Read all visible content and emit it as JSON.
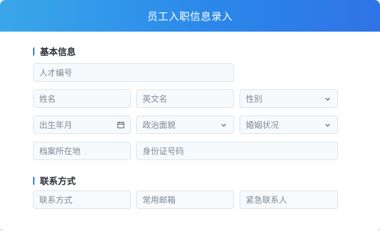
{
  "header": {
    "title": "员工入职信息录入"
  },
  "colors": {
    "accent": "#2b7de9",
    "header_start": "#3aa7e9",
    "header_end": "#2f73e6"
  },
  "sections": {
    "basic": {
      "title": "基本信息"
    },
    "contact": {
      "title": "联系方式"
    }
  },
  "fields": {
    "talent_no": {
      "placeholder": "人才编号"
    },
    "last_name": {
      "placeholder": "姓名"
    },
    "english_name": {
      "placeholder": "英文名"
    },
    "gender": {
      "label": "性别",
      "icon": "chevron-down-icon"
    },
    "birth_date": {
      "label": "出生年月",
      "icon": "calendar-icon"
    },
    "political_status": {
      "label": "政治面貌",
      "icon": "chevron-down-icon"
    },
    "marital_status": {
      "label": "婚姻状况",
      "icon": "chevron-down-icon"
    },
    "archive_location": {
      "placeholder": "档案所在地"
    },
    "id_number": {
      "placeholder": "身份证号码"
    },
    "contact_method": {
      "placeholder": "联系方式"
    },
    "email": {
      "placeholder": "常用邮箱"
    },
    "emergency_contact": {
      "placeholder": "紧急联系人"
    }
  }
}
